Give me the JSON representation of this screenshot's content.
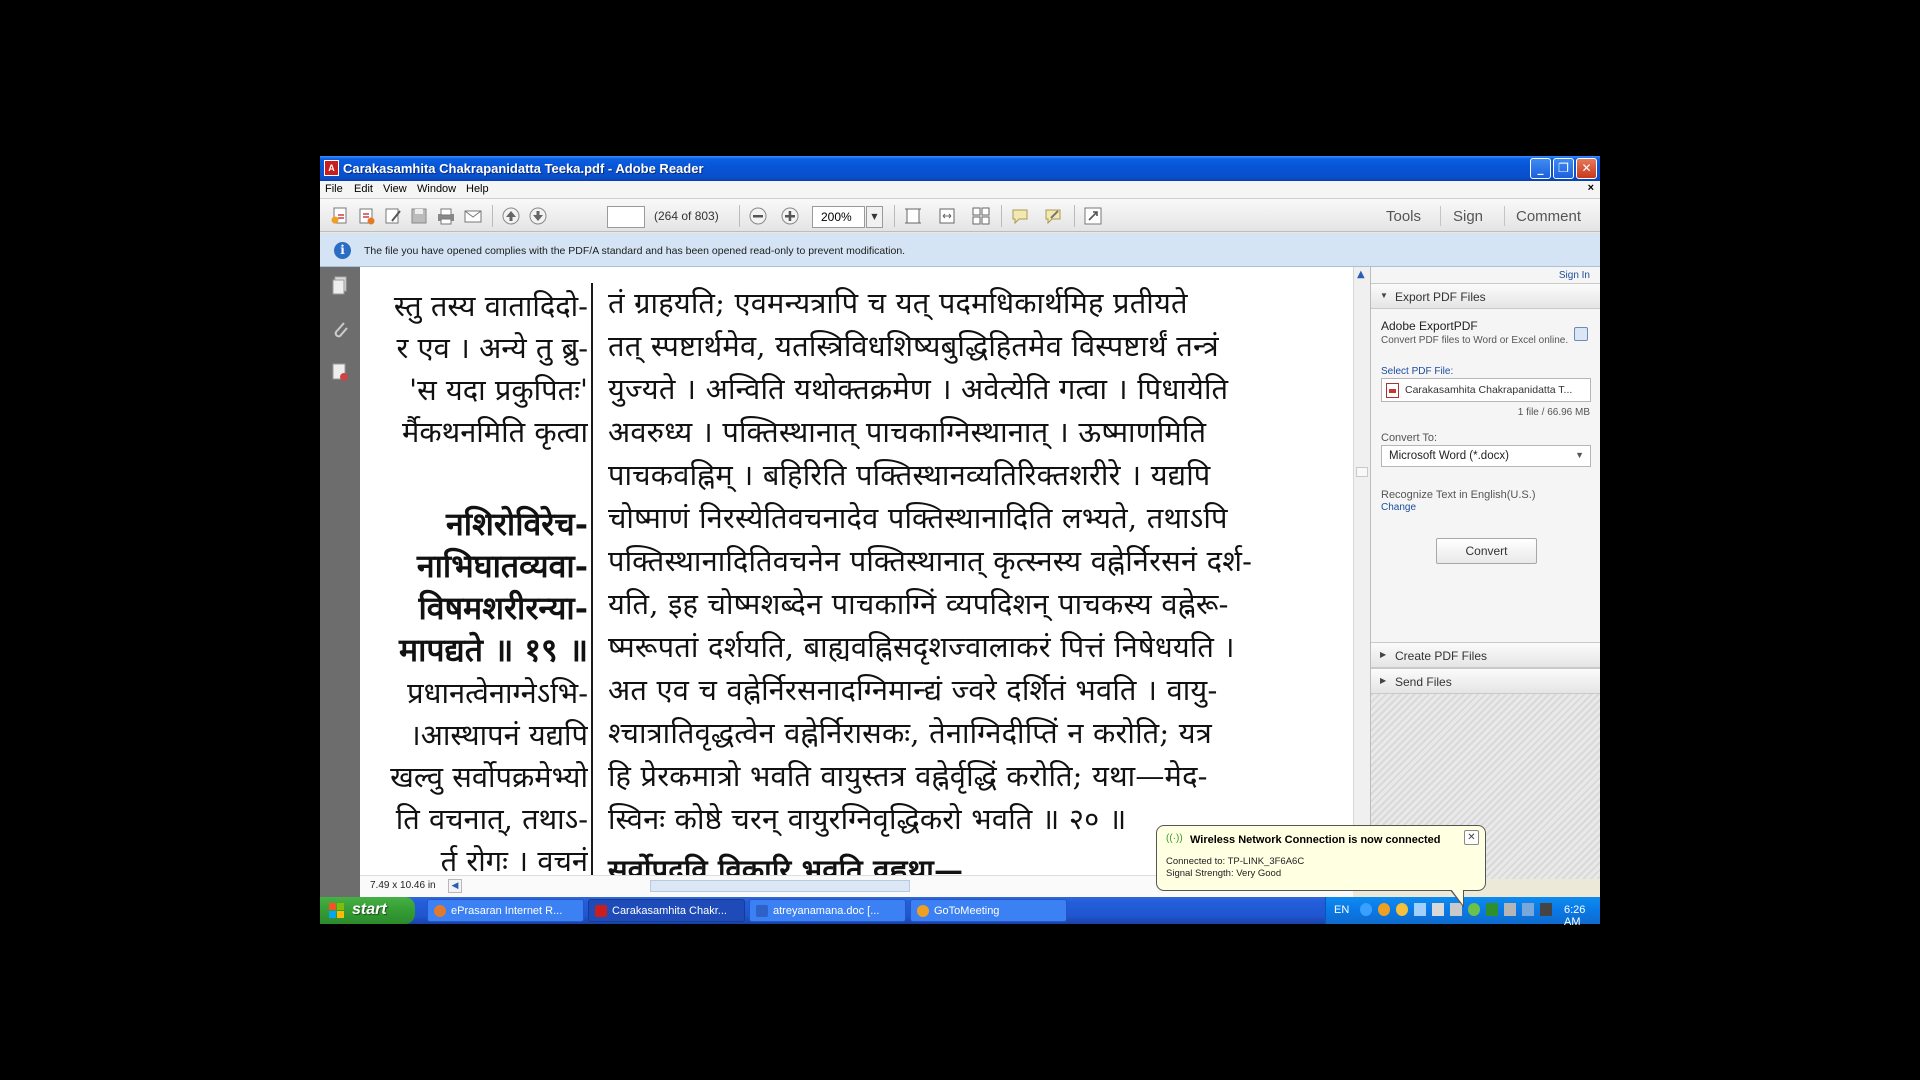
{
  "window": {
    "title": "Carakasamhita Chakrapanidatta Teeka.pdf - Adobe Reader",
    "controls": {
      "minimize": "_",
      "maximize": "❐",
      "close": "✕"
    }
  },
  "menu": {
    "items": [
      "File",
      "Edit",
      "View",
      "Window",
      "Help"
    ],
    "doc_close": "×"
  },
  "toolbar": {
    "page_current": "",
    "page_count": "(264 of 803)",
    "zoom": "200%",
    "tools_label": "Tools",
    "sign_label": "Sign",
    "comment_label": "Comment",
    "icons": [
      "create-pdf-icon",
      "open-icon",
      "edit-icon",
      "save-icon",
      "print-icon",
      "email-icon",
      "prev-page-icon",
      "next-page-icon",
      "zoom-out-icon",
      "zoom-in-icon",
      "fit-page-icon",
      "fit-width-icon",
      "scroll-mode-icon",
      "comment-icon",
      "highlight-icon",
      "fullscreen-icon"
    ]
  },
  "infobar": {
    "text": "The file you have opened complies with the PDF/A standard and has been opened read-only to prevent modification."
  },
  "document": {
    "left_column": [
      "स्तु तस्य वातादिदो-",
      "र एव । अन्ये तु ब्रु-",
      "'स यदा प्रकुपितः'",
      "र्मैकथनमिति कृत्वा",
      "",
      "नशिरोविरेच-",
      "नाभिघातव्यवा-",
      "विषमशरीरन्या-",
      "मापद्यते ॥ १९ ॥",
      "प्रधानत्वेनाग्नेऽभि-",
      "।आस्थापनं यद्यपि",
      "खल्वु सर्वोपक्रमेभ्यो",
      "ति वचनात्, तथाऽ-",
      "र्त रोगः । वचनं"
    ],
    "right_column": [
      "तं ग्राहयति; एवमन्यत्रापि च यत् पदमधिकार्थमिह प्रतीयते",
      "तत् स्पष्टार्थमेव, यतस्त्रिविधशिष्यबुद्धिहितमेव विस्पष्टार्थं तन्त्रं",
      "युज्यते । अन्विति यथोक्तक्रमेण । अवेत्येति गत्वा । पिधायेति",
      "अवरुध्य । पक्तिस्थानात् पाचकाग्निस्थानात् । ऊष्माणमिति",
      "पाचकवह्निम् । बहिरिति पक्तिस्थानव्यतिरिक्तशरीरे । यद्यपि",
      "चोष्माणं निरस्येतिवचनादेव पक्तिस्थानादिति लभ्यते, तथाऽपि",
      "पक्तिस्थानादितिवचनेन पक्तिस्थानात् कृत्स्नस्य वह्नेर्निरसनं दर्श-",
      "यति, इह चोष्मशब्देन पाचकाग्निं व्यपदिशन् पाचकस्य वह्नेरू-",
      "ष्मरूपतां दर्शयति, बाह्यवह्निसदृशज्वालाकरं पित्तं निषेधयति ।",
      "अत एव च वह्नेर्निरसनादग्निमान्द्यं ज्वरे दर्शितं भवति । वायु-",
      "श्चात्रातिवृद्धत्वेन वह्नेर्निरासकः, तेनाग्निदीप्तिं न करोति; यत्र",
      "हि प्रेरकमात्रो भवति वायुस्तत्र वह्नेर्वृद्धिं करोति; यथा—मेद-",
      "स्विनः कोष्ठे चरन् वायुरग्निवृद्धिकरो भवति ॥ २० ॥",
      "सर्वोपद्रवि विकारि भवति वह्नथा—"
    ]
  },
  "status": {
    "page_size": "7.49 x 10.46 in"
  },
  "right_panel": {
    "sign_in": "Sign In",
    "export_title": "Export PDF Files",
    "adobe_export": "Adobe ExportPDF",
    "export_desc": "Convert PDF files to Word or Excel online.",
    "select_label": "Select PDF File:",
    "file_name": "Carakasamhita Chakrapanidatta T...",
    "file_meta": "1 file / 66.96 MB",
    "convert_to_label": "Convert To:",
    "convert_to_value": "Microsoft Word (*.docx)",
    "recognize_text": "Recognize Text in English(U.S.)",
    "change_link": "Change",
    "convert_button": "Convert",
    "create_title": "Create PDF Files",
    "send_title": "Send Files"
  },
  "taskbar": {
    "start_label": "start",
    "tasks": [
      {
        "label": "ePrasaran Internet R...",
        "icon_color": "#e07a2e"
      },
      {
        "label": "Carakasamhita Chakr...",
        "icon_color": "#c81e1e"
      },
      {
        "label": "atreyanamana.doc [...",
        "icon_color": "#2e62c9"
      },
      {
        "label": "GoToMeeting",
        "icon_color": "#f0a020"
      }
    ],
    "lang": "EN",
    "clock": "6:26 AM"
  },
  "balloon": {
    "title": "Wireless Network Connection is now connected",
    "connected_to": "Connected to: TP-LINK_3F6A6C",
    "signal": "Signal Strength: Very Good",
    "close": "✕"
  },
  "colors": {
    "titlebar": "#0853d6",
    "taskbar": "#245edb",
    "start_green": "#37a036",
    "infobar": "#d5e4f4",
    "balloon": "#ffffe1"
  }
}
